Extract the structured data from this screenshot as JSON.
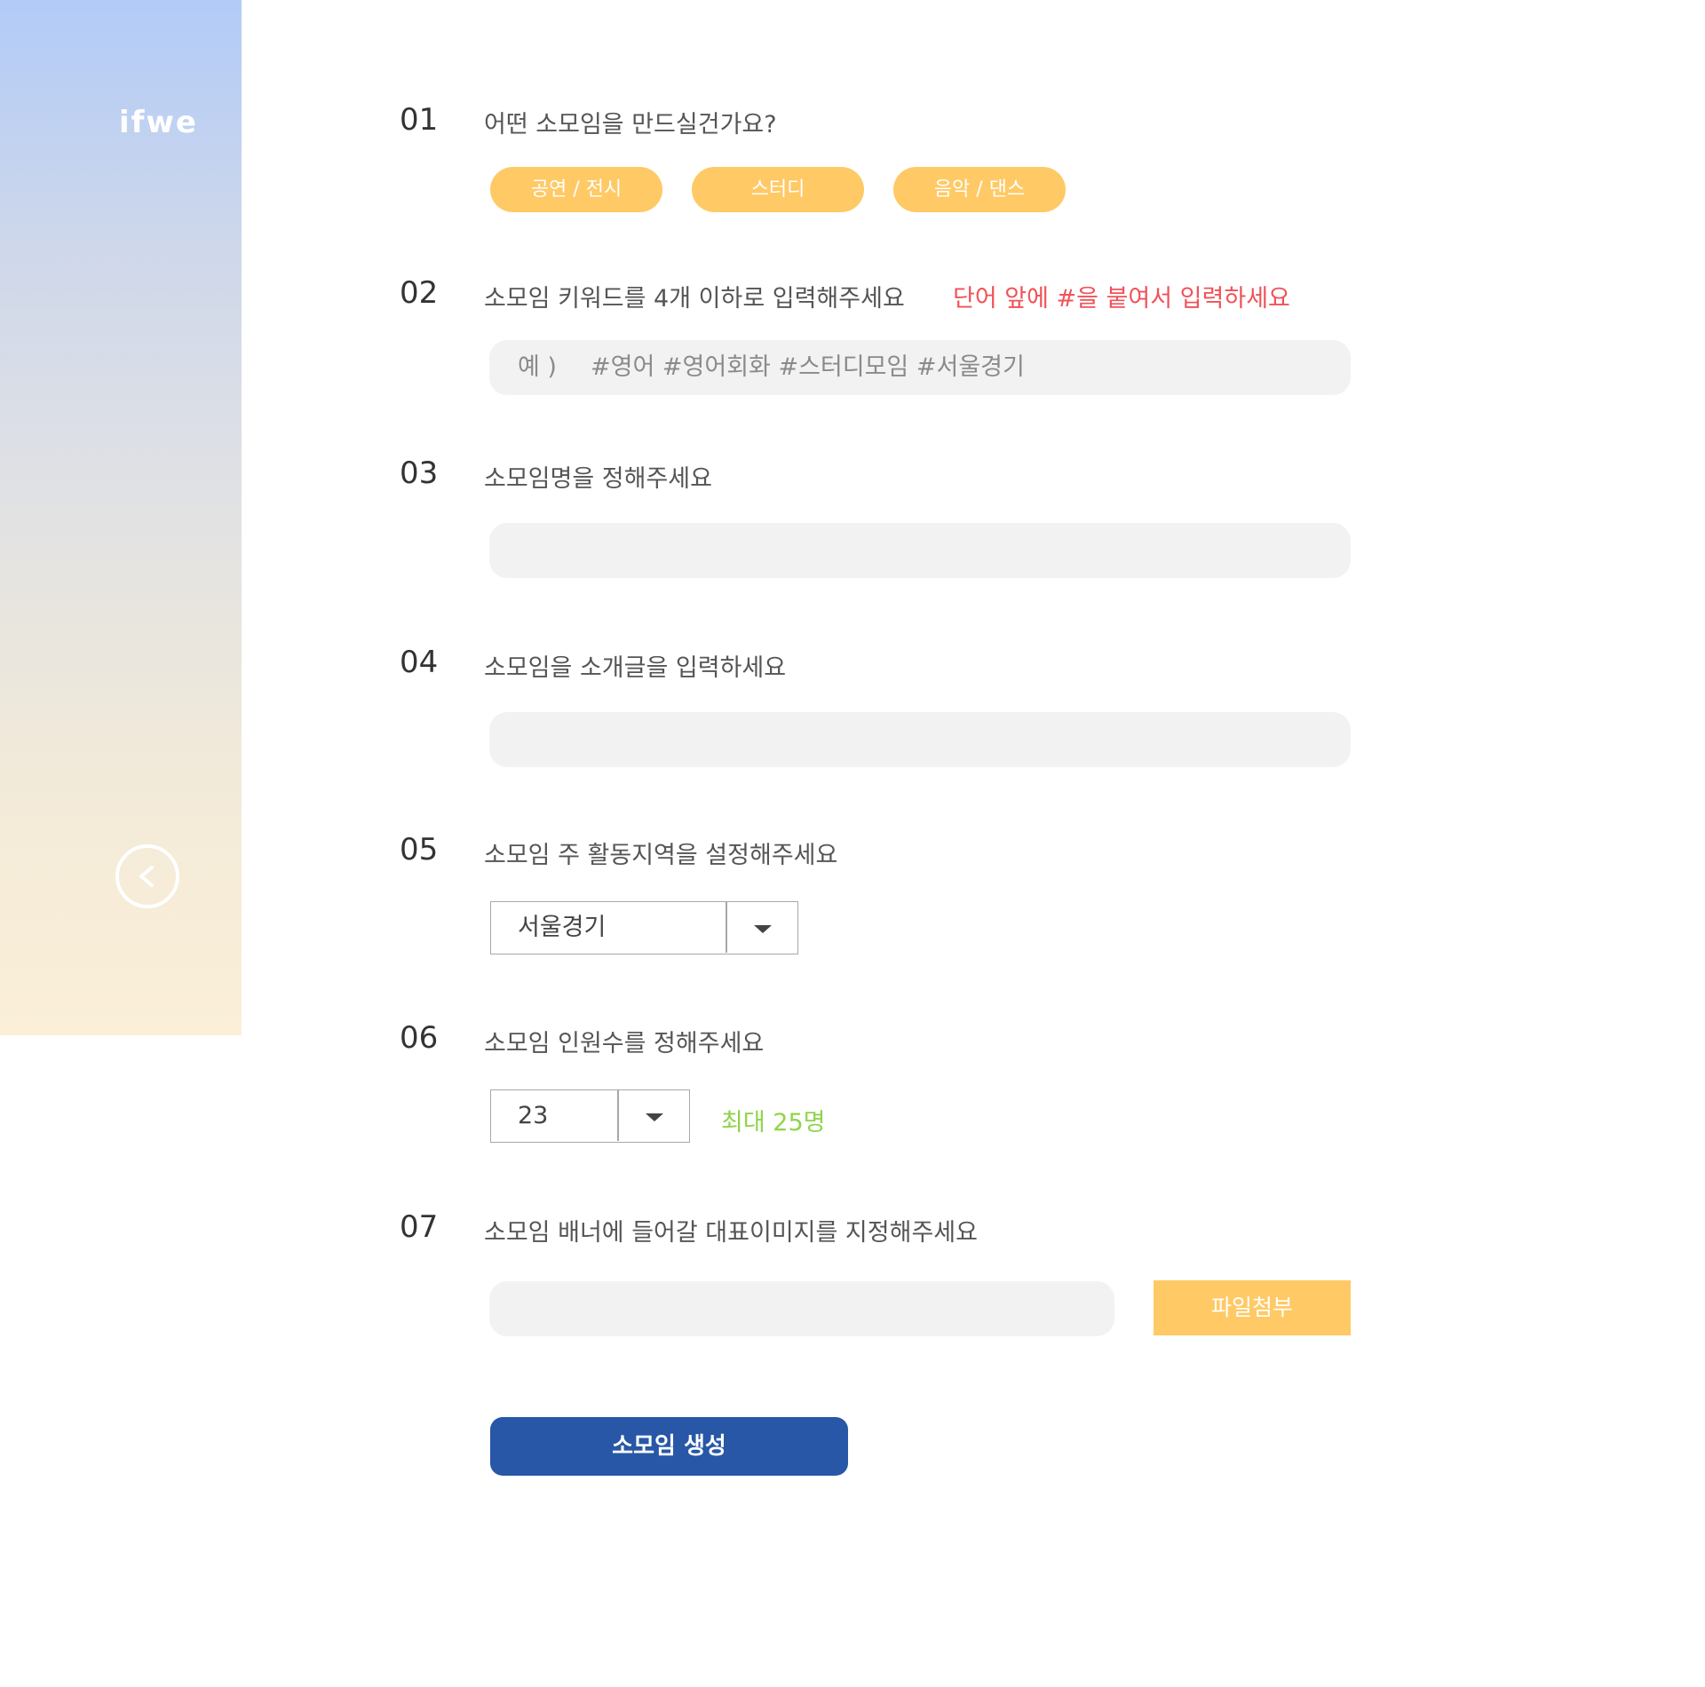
{
  "sidebar": {
    "logo": "ifwe"
  },
  "steps": [
    {
      "num": "01",
      "question": "어떤 소모임을 만드실건가요?"
    },
    {
      "num": "02",
      "question": "소모임 키워드를 4개 이하로 입력해주세요",
      "hint": "단어 앞에 #을 붙여서 입력하세요"
    },
    {
      "num": "03",
      "question": "소모임명을 정해주세요"
    },
    {
      "num": "04",
      "question": "소모임을 소개글을 입력하세요"
    },
    {
      "num": "05",
      "question": "소모임 주 활동지역을 설정해주세요"
    },
    {
      "num": "06",
      "question": "소모임 인원수를 정해주세요",
      "hint": "최대 25명"
    },
    {
      "num": "07",
      "question": "소모임 배너에 들어갈 대표이미지를 지정해주세요"
    }
  ],
  "categories": [
    "공연 / 전시",
    "스터디",
    "음악 / 댄스"
  ],
  "keyword_input": {
    "placeholder_prefix": "예 )",
    "placeholder_text": "#영어 #영어회화 #스터디모임 #서울경기"
  },
  "region_select": {
    "value": "서울경기"
  },
  "member_select": {
    "value": "23"
  },
  "file_upload": {
    "button_label": "파일첨부"
  },
  "submit": {
    "label": "소모임 생성"
  },
  "colors": {
    "accent_yellow": "#ffc965",
    "primary_blue": "#2757a6",
    "hint_red": "#f0525a",
    "hint_green": "#8fd44c"
  },
  "icons": {
    "back": "chevron-left-circle-icon",
    "dropdown": "caret-down-icon"
  }
}
